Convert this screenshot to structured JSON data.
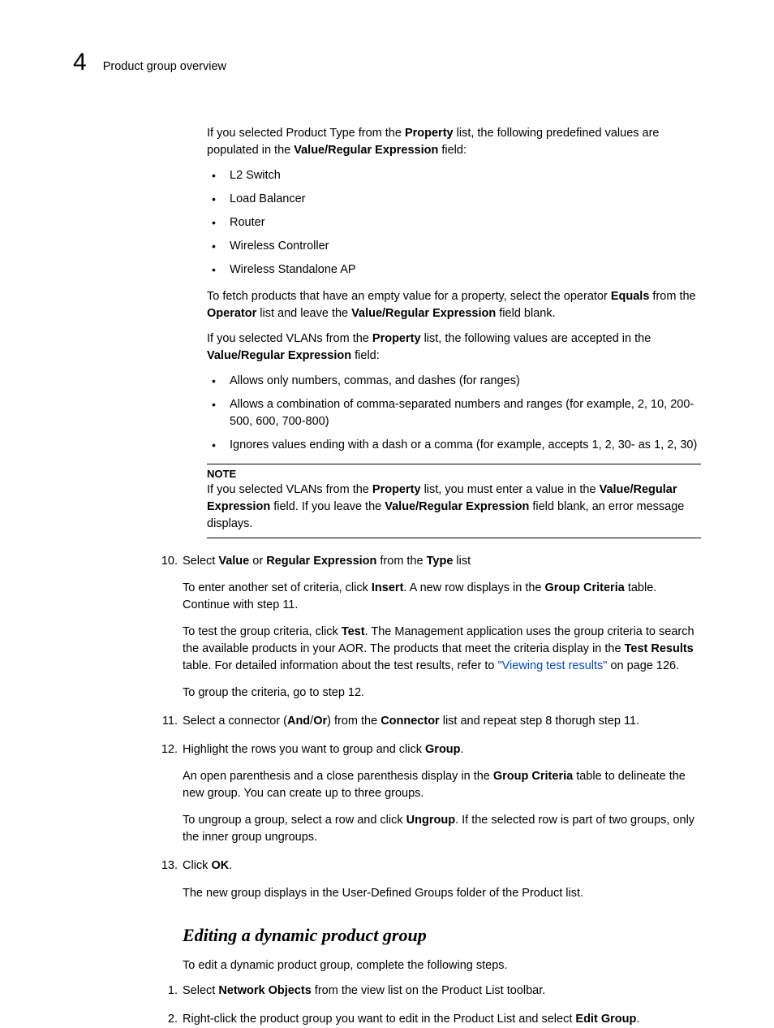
{
  "header": {
    "chapter_number": "4",
    "chapter_title": "Product group overview"
  },
  "p1_a": "If you selected Product Type from the ",
  "p1_b": "Property",
  "p1_c": " list, the following predefined values are populated in the ",
  "p1_d": "Value/Regular Expression",
  "p1_e": " field:",
  "list1": {
    "i1": "L2 Switch",
    "i2": "Load Balancer",
    "i3": "Router",
    "i4": "Wireless Controller",
    "i5": "Wireless Standalone AP"
  },
  "p2_a": "To fetch products that have an empty value for a property, select the operator ",
  "p2_b": "Equals",
  "p2_c": " from the ",
  "p2_d": "Operator",
  "p2_e": " list and leave the ",
  "p2_f": "Value/Regular Expression",
  "p2_g": " field blank.",
  "p3_a": "If you selected VLANs from the ",
  "p3_b": "Property",
  "p3_c": " list, the following values are accepted in the ",
  "p3_d": "Value/Regular Expression",
  "p3_e": " field:",
  "list2": {
    "i1": "Allows only numbers, commas, and dashes (for ranges)",
    "i2": "Allows a combination of comma-separated numbers and ranges (for example, 2, 10, 200-500, 600, 700-800)",
    "i3": "Ignores values ending with a dash or a comma (for example, accepts 1, 2, 30- as 1, 2, 30)"
  },
  "note": {
    "label": "NOTE",
    "a": "If you selected VLANs from the ",
    "b": "Property",
    "c": " list, you must enter a value in the ",
    "d": "Value/Regular Expression",
    "e": " field. If you leave the ",
    "f": "Value/Regular Expression",
    "g": " field blank, an error message displays."
  },
  "s10": {
    "num": "10.",
    "a": "Select ",
    "b": "Value",
    "c": " or ",
    "d": "Regular Expression",
    "e": " from the ",
    "f": "Type",
    "g": " list",
    "p2a": "To enter another set of criteria, click ",
    "p2b": "Insert",
    "p2c": ". A new row displays in the ",
    "p2d": "Group Criteria",
    "p2e": " table. Continue with step 11.",
    "p3a": "To test the group criteria, click ",
    "p3b": "Test",
    "p3c": ". The Management application uses the group criteria to search the available products in your AOR. The products that meet the criteria display in the ",
    "p3d": "Test Results",
    "p3e": " table. For detailed information about the test results, refer to ",
    "p3f": "\"Viewing test results\"",
    "p3g": " on page 126.",
    "p4": "To group the criteria, go to step 12."
  },
  "s11": {
    "num": "11.",
    "a": "Select a connector (",
    "b": "And",
    "c": "/",
    "d": "Or",
    "e": ") from the ",
    "f": "Connector",
    "g": " list and repeat step 8 thorugh step 11."
  },
  "s12": {
    "num": "12.",
    "a": "Highlight the rows you want to group and click ",
    "b": "Group",
    "c": ".",
    "p2a": "An open parenthesis and a close parenthesis display in the ",
    "p2b": "Group Criteria",
    "p2c": " table to delineate the new group. You can create up to three groups.",
    "p3a": "To ungroup a group, select a row and click ",
    "p3b": "Ungroup",
    "p3c": ". If the selected row is part of two groups, only the inner group ungroups."
  },
  "s13": {
    "num": "13.",
    "a": "Click ",
    "b": "OK",
    "c": ".",
    "p2": "The new group displays in the User-Defined Groups folder of the Product list."
  },
  "h2": "Editing a dynamic product group",
  "edit_intro": "To edit a dynamic product group, complete the following steps.",
  "e1": {
    "num": "1.",
    "a": "Select ",
    "b": "Network Objects",
    "c": " from the view list on the Product List toolbar."
  },
  "e2": {
    "num": "2.",
    "a": "Right-click the product group you want to edit in the Product List and select ",
    "b": "Edit Group",
    "c": "."
  }
}
